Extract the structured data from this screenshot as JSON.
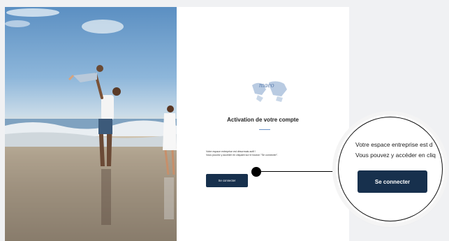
{
  "card": {
    "logo_text": "maeo",
    "title": "Activation de votre compte",
    "message_line1": "Votre espace entreprise est désormais actif !",
    "message_line2": "Vous pouvez y accéder en cliquant sur le bouton \"Se connecter\".",
    "button_label": "Se connecter"
  },
  "magnifier": {
    "line1": "Votre espace entreprise est d",
    "line2": "Vous pouvez y accéder en cliq",
    "button_label": "Se connecter"
  },
  "colors": {
    "button": "#17304d",
    "accent": "#6a93c8",
    "background": "#f0f1f3"
  },
  "icons": [
    "world-map-logo-icon"
  ]
}
